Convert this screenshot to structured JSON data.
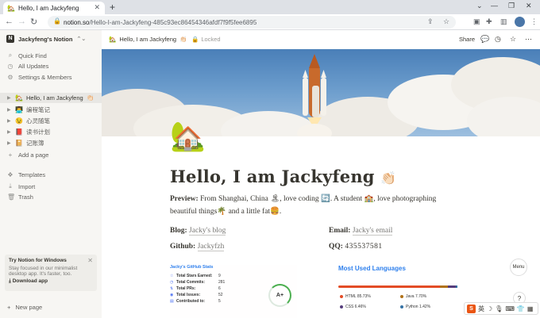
{
  "browser": {
    "tab_title": "Hello, I am Jackyfeng",
    "tab_favicon": "🏡",
    "url_domain": "notion.so",
    "url_path": "/Hello-I-am-Jackyfeng-485c93ec86454346afdf7f9f5fee6895"
  },
  "sidebar": {
    "workspace": "Jackyfeng's Notion",
    "nav": [
      {
        "icon": "search-icon",
        "label": "Quick Find"
      },
      {
        "icon": "clock-icon",
        "label": "All Updates"
      },
      {
        "icon": "gear-icon",
        "label": "Settings & Members"
      }
    ],
    "pages": [
      {
        "emoji": "🏡",
        "label": "Hello, I am Jackyfeng",
        "suffix": "👏🏻"
      },
      {
        "emoji": "👨‍💻",
        "label": "编程笔记"
      },
      {
        "emoji": "😉",
        "label": "心灵随笔"
      },
      {
        "emoji": "📕",
        "label": "读书计划"
      },
      {
        "emoji": "📔",
        "label": "记账簿"
      }
    ],
    "add_page": "Add a page",
    "tools": [
      {
        "icon": "templates-icon",
        "label": "Templates"
      },
      {
        "icon": "import-icon",
        "label": "Import"
      },
      {
        "icon": "trash-icon",
        "label": "Trash"
      }
    ],
    "promo": {
      "title": "Try Notion for Windows",
      "body": "Stay focused in our minimalist desktop app. It's faster, too.",
      "link": "Download app"
    },
    "new_page": "New page"
  },
  "topbar": {
    "crumb": "Hello, I am Jackyfeng",
    "crumb_emoji": "🏡",
    "crumb_suffix": "👏🏻",
    "locked": "Locked",
    "share": "Share"
  },
  "page": {
    "icon": "🏡",
    "title": "Hello, I am Jackyfeng",
    "title_emoji": "👏🏻",
    "preview_label": "Preview",
    "preview_text": "From Shanghai, China 🏝, love coding 🔄. A student 🏫, love photographing beautiful things🌴 and a little fat🍔.",
    "blog_label": "Blog",
    "blog_link": "Jacky's blog",
    "email_label": "Email",
    "email_link": "Jacky's email",
    "github_label": "Github",
    "github_link": "Jackyfzh",
    "qq_label": "QQ",
    "qq_value": "435537581"
  },
  "github_stats": {
    "title": "Jacky's GitHub Stats",
    "rows": [
      {
        "label": "Total Stars Earned:",
        "value": "9"
      },
      {
        "label": "Total Commits:",
        "value": "281"
      },
      {
        "label": "Total PRs:",
        "value": "6"
      },
      {
        "label": "Total Issues:",
        "value": "52"
      },
      {
        "label": "Contributed to:",
        "value": "5"
      }
    ],
    "grade": "A+"
  },
  "languages": {
    "title": "Most Used Languages",
    "items": [
      {
        "label": "HTML 85.73%",
        "color": "#e34c26"
      },
      {
        "label": "Java 7.70%",
        "color": "#b07219"
      },
      {
        "label": "CSS 6.46%",
        "color": "#563d7c"
      },
      {
        "label": "Python 1.42%",
        "color": "#3572A5"
      }
    ]
  },
  "float": {
    "menu": "Menu",
    "help": "?"
  },
  "ime": {
    "mode": "英"
  }
}
